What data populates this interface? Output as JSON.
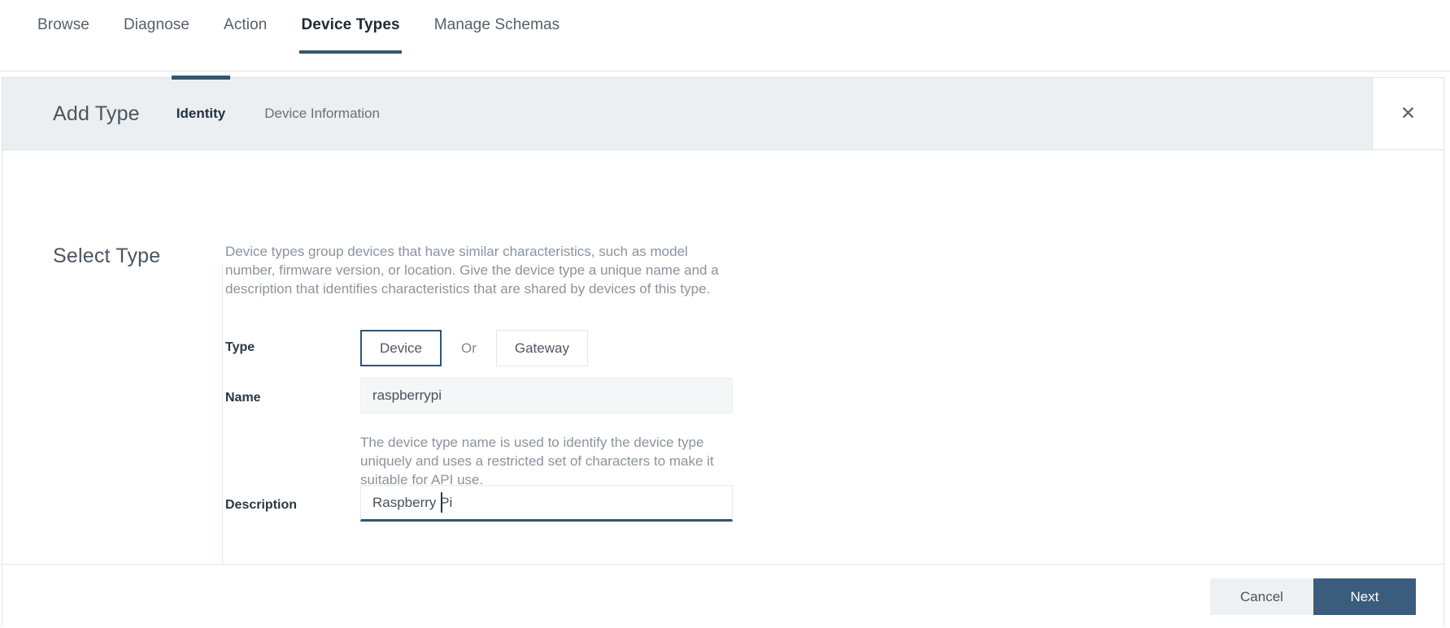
{
  "topnav": {
    "items": [
      {
        "label": "Browse",
        "active": false
      },
      {
        "label": "Diagnose",
        "active": false
      },
      {
        "label": "Action",
        "active": false
      },
      {
        "label": "Device Types",
        "active": true
      },
      {
        "label": "Manage Schemas",
        "active": false
      }
    ]
  },
  "modal": {
    "title": "Add Type",
    "tabs": [
      {
        "label": "Identity",
        "active": true
      },
      {
        "label": "Device Information",
        "active": false
      }
    ],
    "close_icon": "close-icon",
    "section_title": "Select Type",
    "intro_text": "Device types group devices that have similar characteristics, such as model number, firmware version, or location. Give the device type a unique name and a description that identifies characteristics that are shared by devices of this type.",
    "form": {
      "type": {
        "label": "Type",
        "options": [
          {
            "label": "Device",
            "selected": true
          },
          {
            "label": "Gateway",
            "selected": false
          }
        ],
        "separator": "Or"
      },
      "name": {
        "label": "Name",
        "value": "raspberrypi",
        "placeholder": "",
        "helper": "The device type name is used to identify the device type uniquely and uses a restricted set of characters to make it suitable for API use."
      },
      "description": {
        "label": "Description",
        "value": "Raspberry Pi",
        "placeholder": "",
        "focused": true
      }
    },
    "footer": {
      "cancel_label": "Cancel",
      "next_label": "Next"
    }
  },
  "colors": {
    "accent_navy": "#33566f",
    "primary_button": "#3a5d7d",
    "header_band": "#eceff1",
    "muted_text": "#8a949e"
  }
}
